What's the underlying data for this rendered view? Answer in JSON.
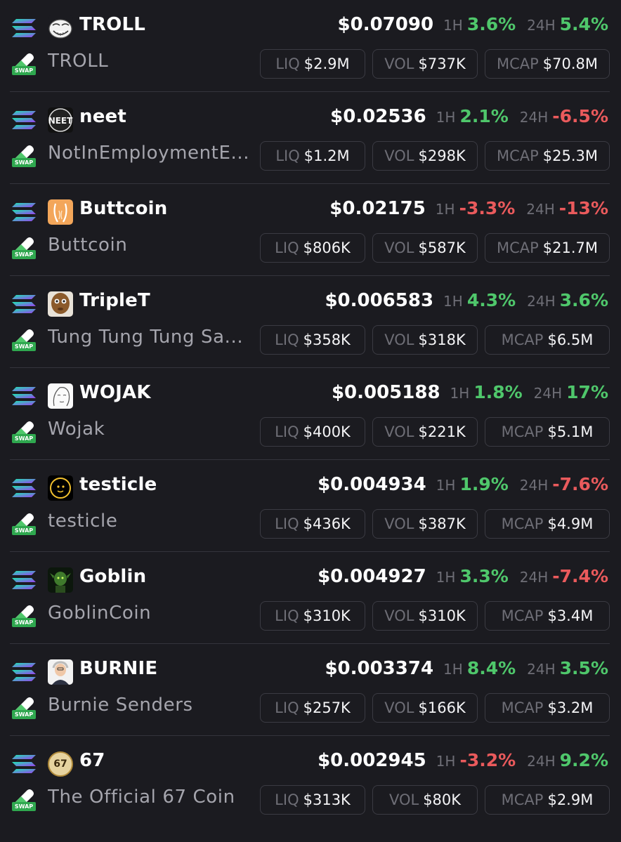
{
  "labels": {
    "h1": "1H",
    "h24": "24H",
    "liq": "LIQ",
    "vol": "VOL",
    "mcap": "MCAP",
    "swap": "SWAP"
  },
  "colors": {
    "up": "#4fc76b",
    "down": "#ea5a5c",
    "background": "#1b1b20"
  },
  "tokens": [
    {
      "symbol": "TROLL",
      "name": "TROLL",
      "icon": "troll-face-icon",
      "price": "$0.07090",
      "h1": "3.6%",
      "h1_dir": "up",
      "h24": "5.4%",
      "h24_dir": "up",
      "liq": "$2.9M",
      "vol": "$737K",
      "mcap": "$70.8M"
    },
    {
      "symbol": "neet",
      "name": "NotInEmploymentE...",
      "icon": "neet-logo-icon",
      "price": "$0.02536",
      "h1": "2.1%",
      "h1_dir": "up",
      "h24": "-6.5%",
      "h24_dir": "down",
      "liq": "$1.2M",
      "vol": "$298K",
      "mcap": "$25.3M"
    },
    {
      "symbol": "Buttcoin",
      "name": "Buttcoin",
      "icon": "buttcoin-icon",
      "price": "$0.02175",
      "h1": "-3.3%",
      "h1_dir": "down",
      "h24": "-13%",
      "h24_dir": "down",
      "liq": "$806K",
      "vol": "$587K",
      "mcap": "$21.7M"
    },
    {
      "symbol": "TripleT",
      "name": "Tung Tung Tung Sa...",
      "icon": "triplet-face-icon",
      "price": "$0.006583",
      "h1": "4.3%",
      "h1_dir": "up",
      "h24": "3.6%",
      "h24_dir": "up",
      "liq": "$358K",
      "vol": "$318K",
      "mcap": "$6.5M"
    },
    {
      "symbol": "WOJAK",
      "name": "Wojak",
      "icon": "wojak-face-icon",
      "price": "$0.005188",
      "h1": "1.8%",
      "h1_dir": "up",
      "h24": "17%",
      "h24_dir": "up",
      "liq": "$400K",
      "vol": "$221K",
      "mcap": "$5.1M"
    },
    {
      "symbol": "testicle",
      "name": "testicle",
      "icon": "testicle-icon",
      "price": "$0.004934",
      "h1": "1.9%",
      "h1_dir": "up",
      "h24": "-7.6%",
      "h24_dir": "down",
      "liq": "$436K",
      "vol": "$387K",
      "mcap": "$4.9M"
    },
    {
      "symbol": "Goblin",
      "name": "GoblinCoin",
      "icon": "goblin-icon",
      "price": "$0.004927",
      "h1": "3.3%",
      "h1_dir": "up",
      "h24": "-7.4%",
      "h24_dir": "down",
      "liq": "$310K",
      "vol": "$310K",
      "mcap": "$3.4M"
    },
    {
      "symbol": "BURNIE",
      "name": "Burnie Senders",
      "icon": "burnie-portrait-icon",
      "price": "$0.003374",
      "h1": "8.4%",
      "h1_dir": "up",
      "h24": "3.5%",
      "h24_dir": "up",
      "liq": "$257K",
      "vol": "$166K",
      "mcap": "$3.2M"
    },
    {
      "symbol": "67",
      "name": "The Official 67 Coin",
      "icon": "coin-67-icon",
      "icon_text": "67",
      "price": "$0.002945",
      "h1": "-3.2%",
      "h1_dir": "down",
      "h24": "9.2%",
      "h24_dir": "up",
      "liq": "$313K",
      "vol": "$80K",
      "mcap": "$2.9M"
    }
  ]
}
